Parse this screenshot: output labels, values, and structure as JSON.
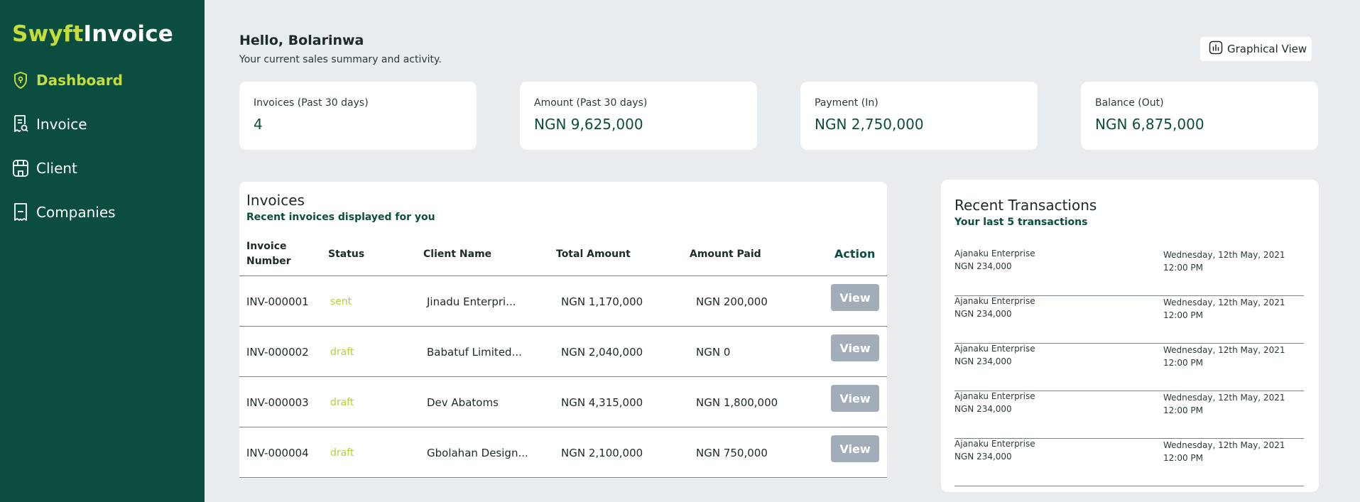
{
  "brand": {
    "part1": "Swyft",
    "part2": "Invoice"
  },
  "nav": [
    {
      "label": "Dashboard",
      "icon": "shield-icon",
      "active": true
    },
    {
      "label": "Invoice",
      "icon": "receipt-search-icon",
      "active": false
    },
    {
      "label": "Client",
      "icon": "store-icon",
      "active": false
    },
    {
      "label": "Companies",
      "icon": "document-icon",
      "active": false
    }
  ],
  "header": {
    "greeting": "Hello, Bolarinwa",
    "subtitle": "Your current sales summary and activity.",
    "graphical_view": "Graphical View"
  },
  "cards": [
    {
      "title": "Invoices (Past 30 days)",
      "value": "4"
    },
    {
      "title": "Amount (Past 30 days)",
      "value": "NGN 9,625,000"
    },
    {
      "title": "Payment (In)",
      "value": "NGN 2,750,000"
    },
    {
      "title": "Balance (Out)",
      "value": "NGN 6,875,000"
    }
  ],
  "invoices": {
    "title": "Invoices",
    "subtitle": "Recent invoices displayed for you",
    "columns": {
      "number_line1": "Invoice",
      "number_line2": "Number",
      "status": "Status",
      "client": "Client Name",
      "total": "Total Amount",
      "paid": "Amount Paid",
      "action": "Action"
    },
    "rows": [
      {
        "number": "INV-000001",
        "status": "sent",
        "client": "Jinadu Enterpri...",
        "total": "NGN 1,170,000",
        "paid": "NGN 200,000",
        "action": "View"
      },
      {
        "number": "INV-000002",
        "status": "draft",
        "client": "Babatuf Limited...",
        "total": "NGN 2,040,000",
        "paid": "NGN 0",
        "action": "View"
      },
      {
        "number": "INV-000003",
        "status": "draft",
        "client": "Dev Abatoms",
        "total": "NGN 4,315,000",
        "paid": "NGN 1,800,000",
        "action": "View"
      },
      {
        "number": "INV-000004",
        "status": "draft",
        "client": "Gbolahan Design...",
        "total": "NGN 2,100,000",
        "paid": "NGN 750,000",
        "action": "View"
      }
    ]
  },
  "transactions": {
    "title": "Recent Transactions",
    "subtitle": "Your last 5 transactions",
    "items": [
      {
        "client": "Ajanaku Enterprise",
        "amount": "NGN 234,000",
        "date": "Wednesday, 12th May, 2021 12:00 PM"
      },
      {
        "client": "Ajanaku Enterprise",
        "amount": "NGN 234,000",
        "date": "Wednesday, 12th May, 2021 12:00 PM"
      },
      {
        "client": "Ajanaku Enterprise",
        "amount": "NGN 234,000",
        "date": "Wednesday, 12th May, 2021 12:00 PM"
      },
      {
        "client": "Ajanaku Enterprise",
        "amount": "NGN 234,000",
        "date": "Wednesday, 12th May, 2021 12:00 PM"
      },
      {
        "client": "Ajanaku Enterprise",
        "amount": "NGN 234,000",
        "date": "Wednesday, 12th May, 2021 12:00 PM"
      }
    ]
  },
  "colors": {
    "sidebar": "#0b4d3e",
    "accent": "#c4dd3a",
    "background": "#e8ecef",
    "view_button": "#a3adb9"
  }
}
